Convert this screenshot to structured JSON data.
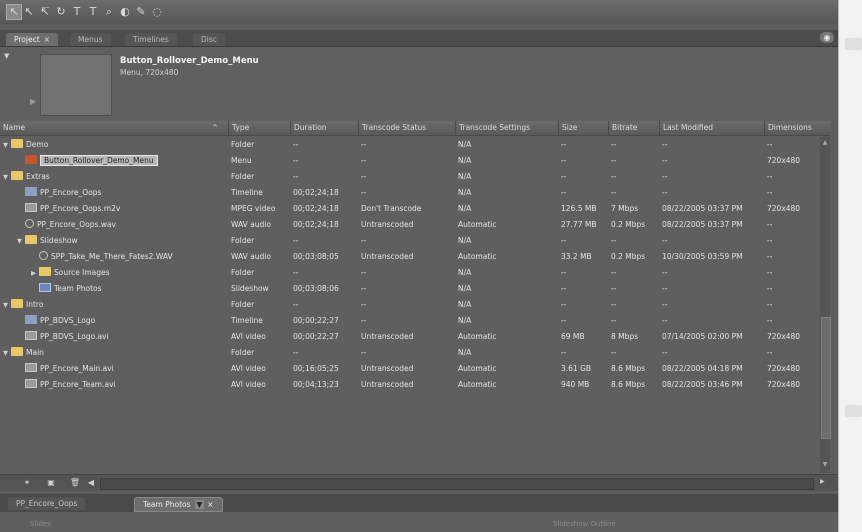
{
  "tabs": [
    {
      "label": "Project",
      "close": "×",
      "active": true
    },
    {
      "label": "Menus"
    },
    {
      "label": "Timelines"
    },
    {
      "label": "Disc"
    }
  ],
  "preview": {
    "title": "Button_Rollover_Demo_Menu",
    "subtitle": "Menu, 720x480"
  },
  "table": {
    "columns": [
      "Name",
      "Type",
      "Duration",
      "Transcode Status",
      "Transcode Settings",
      "Size",
      "Bitrate",
      "Last Modified",
      "Dimensions"
    ],
    "sort_indicator": "^",
    "rows": [
      {
        "indent": 0,
        "twisty": "▼",
        "icon": "folder",
        "name": "Demo",
        "type": "Folder",
        "duration": "--",
        "status": "--",
        "settings": "N/A",
        "size": "--",
        "bitrate": "--",
        "modified": "--",
        "dims": "--"
      },
      {
        "indent": 1,
        "twisty": "",
        "icon": "menu",
        "name": "Button_Rollover_Demo_Menu",
        "selected": true,
        "type": "Menu",
        "duration": "--",
        "status": "--",
        "settings": "N/A",
        "size": "--",
        "bitrate": "--",
        "modified": "--",
        "dims": "720x480"
      },
      {
        "indent": 0,
        "twisty": "▼",
        "icon": "folder",
        "name": "Extras",
        "type": "Folder",
        "duration": "--",
        "status": "--",
        "settings": "N/A",
        "size": "--",
        "bitrate": "--",
        "modified": "--",
        "dims": "--"
      },
      {
        "indent": 1,
        "twisty": "",
        "icon": "timeline",
        "name": "PP_Encore_Oops",
        "type": "Timeline",
        "duration": "00;02;24;18",
        "status": "--",
        "settings": "N/A",
        "size": "--",
        "bitrate": "--",
        "modified": "--",
        "dims": "--"
      },
      {
        "indent": 1,
        "twisty": "",
        "icon": "video",
        "name": "PP_Encore_Oops.m2v",
        "type": "MPEG video",
        "duration": "00;02;24;18",
        "status": "Don't Transcode",
        "settings": "N/A",
        "size": "126.5 MB",
        "bitrate": "7 Mbps",
        "modified": "08/22/2005 03:37 PM",
        "dims": "720x480"
      },
      {
        "indent": 1,
        "twisty": "",
        "icon": "audio",
        "name": "PP_Encore_Oops.wav",
        "type": "WAV audio",
        "duration": "00;02;24;18",
        "status": "Untranscoded",
        "settings": "Automatic",
        "size": "27.77 MB",
        "bitrate": "0.2 Mbps",
        "modified": "08/22/2005 03:37 PM",
        "dims": "--"
      },
      {
        "indent": 1,
        "twisty": "▼",
        "icon": "folder",
        "name": "Slideshow",
        "type": "Folder",
        "duration": "--",
        "status": "--",
        "settings": "N/A",
        "size": "--",
        "bitrate": "--",
        "modified": "--",
        "dims": "--"
      },
      {
        "indent": 2,
        "twisty": "",
        "icon": "audio",
        "name": "SPP_Take_Me_There_Fates2.WAV",
        "type": "WAV audio",
        "duration": "00;03;08;05",
        "status": "Untranscoded",
        "settings": "Automatic",
        "size": "33.2 MB",
        "bitrate": "0.2 Mbps",
        "modified": "10/30/2005 03:59 PM",
        "dims": "--"
      },
      {
        "indent": 2,
        "twisty": "▶",
        "icon": "folder",
        "name": "Source Images",
        "type": "Folder",
        "duration": "--",
        "status": "--",
        "settings": "N/A",
        "size": "--",
        "bitrate": "--",
        "modified": "--",
        "dims": "--"
      },
      {
        "indent": 2,
        "twisty": "",
        "icon": "slideshow",
        "name": "Team Photos",
        "type": "Slideshow",
        "duration": "00;03;08;06",
        "status": "--",
        "settings": "N/A",
        "size": "--",
        "bitrate": "--",
        "modified": "--",
        "dims": "--"
      },
      {
        "indent": 0,
        "twisty": "▼",
        "icon": "folder",
        "name": "Intro",
        "type": "Folder",
        "duration": "--",
        "status": "--",
        "settings": "N/A",
        "size": "--",
        "bitrate": "--",
        "modified": "--",
        "dims": "--"
      },
      {
        "indent": 1,
        "twisty": "",
        "icon": "timeline",
        "name": "PP_BDVS_Logo",
        "type": "Timeline",
        "duration": "00;00;22;27",
        "status": "--",
        "settings": "N/A",
        "size": "--",
        "bitrate": "--",
        "modified": "--",
        "dims": "--"
      },
      {
        "indent": 1,
        "twisty": "",
        "icon": "video",
        "name": "PP_BDVS_Logo.avi",
        "type": "AVI video",
        "duration": "00;00;22;27",
        "status": "Untranscoded",
        "settings": "Automatic",
        "size": "69 MB",
        "bitrate": "8 Mbps",
        "modified": "07/14/2005 02:00 PM",
        "dims": "720x480"
      },
      {
        "indent": 0,
        "twisty": "▼",
        "icon": "folder",
        "name": "Main",
        "type": "Folder",
        "duration": "--",
        "status": "--",
        "settings": "N/A",
        "size": "--",
        "bitrate": "--",
        "modified": "--",
        "dims": "--"
      },
      {
        "indent": 1,
        "twisty": "",
        "icon": "video",
        "name": "PP_Encore_Main.avi",
        "type": "AVI video",
        "duration": "00;16;05;25",
        "status": "Untranscoded",
        "settings": "Automatic",
        "size": "3.61 GB",
        "bitrate": "8.6 Mbps",
        "modified": "08/22/2005 04:18 PM",
        "dims": "720x480"
      },
      {
        "indent": 1,
        "twisty": "",
        "icon": "video",
        "name": "PP_Encore_Team.avi",
        "type": "AVI video",
        "duration": "00;04;13;23",
        "status": "Untranscoded",
        "settings": "Automatic",
        "size": "940 MB",
        "bitrate": "8.6 Mbps",
        "modified": "08/22/2005 03:46 PM",
        "dims": "720x480"
      }
    ]
  },
  "bottom_tabs": [
    {
      "label": "PP_Encore_Oops"
    },
    {
      "label": "Team Photos",
      "dropdown": "▼",
      "close": "×",
      "active": true
    }
  ],
  "bottom_panel": {
    "slides_label": "Slides",
    "outline_label": "Slideshow Outline"
  },
  "icons": {
    "menu_button": "◉",
    "scroll_up": "▲",
    "scroll_down": "▼",
    "scroll_right": "▶"
  }
}
